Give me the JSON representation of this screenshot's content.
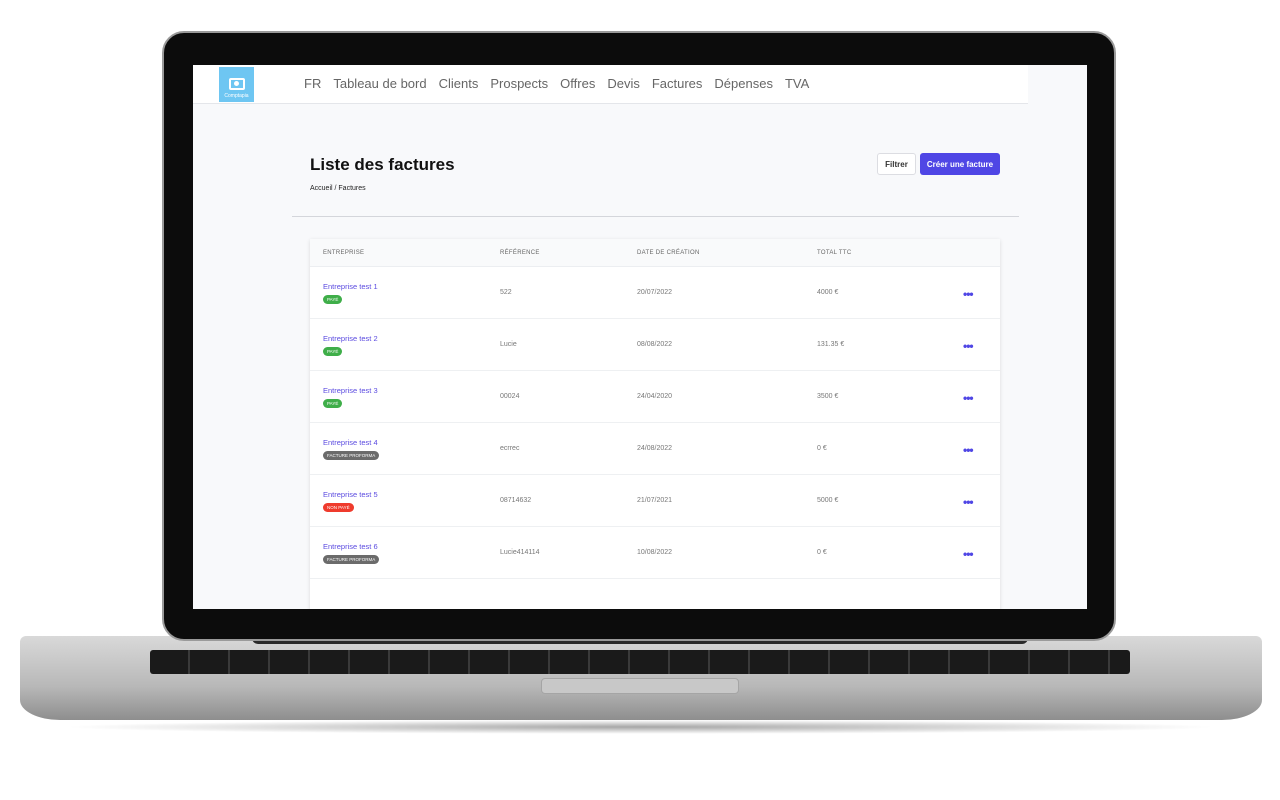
{
  "nav": {
    "logo_text": "Comptapia",
    "items": [
      "FR",
      "Tableau de bord",
      "Clients",
      "Prospects",
      "Offres",
      "Devis",
      "Factures",
      "Dépenses",
      "TVA"
    ]
  },
  "page": {
    "title": "Liste des factures",
    "breadcrumb": "Accueil / Factures",
    "filter_label": "Filtrer",
    "create_label": "Créer une facture"
  },
  "table": {
    "headers": [
      "ENTREPRISE",
      "RÉFÉRENCE",
      "DATE DE CRÉATION",
      "TOTAL TTC"
    ],
    "rows": [
      {
        "company": "Entreprise test 1",
        "status": "PAYÉ",
        "status_color": "#3fae49",
        "reference": "522",
        "date": "20/07/2022",
        "total": "4000 €"
      },
      {
        "company": "Entreprise test 2",
        "status": "PAYÉ",
        "status_color": "#3fae49",
        "reference": "Lucie",
        "date": "08/08/2022",
        "total": "131.35 €"
      },
      {
        "company": "Entreprise test 3",
        "status": "PAYÉ",
        "status_color": "#3fae49",
        "reference": "00024",
        "date": "24/04/2020",
        "total": "3500 €"
      },
      {
        "company": "Entreprise test 4",
        "status": "FACTURE PROFORMA",
        "status_color": "#6b6b6b",
        "reference": "ecrrec",
        "date": "24/08/2022",
        "total": "0 €"
      },
      {
        "company": "Entreprise test 5",
        "status": "NON PAYÉ",
        "status_color": "#ef3b2d",
        "reference": "08714632",
        "date": "21/07/2021",
        "total": "5000 €"
      },
      {
        "company": "Entreprise test 6",
        "status": "FACTURE PROFORMA",
        "status_color": "#6b6b6b",
        "reference": "Lucie414114",
        "date": "10/08/2022",
        "total": "0 €"
      }
    ]
  },
  "colors": {
    "accent": "#4f46e5",
    "logo": "#6ec6f2"
  }
}
